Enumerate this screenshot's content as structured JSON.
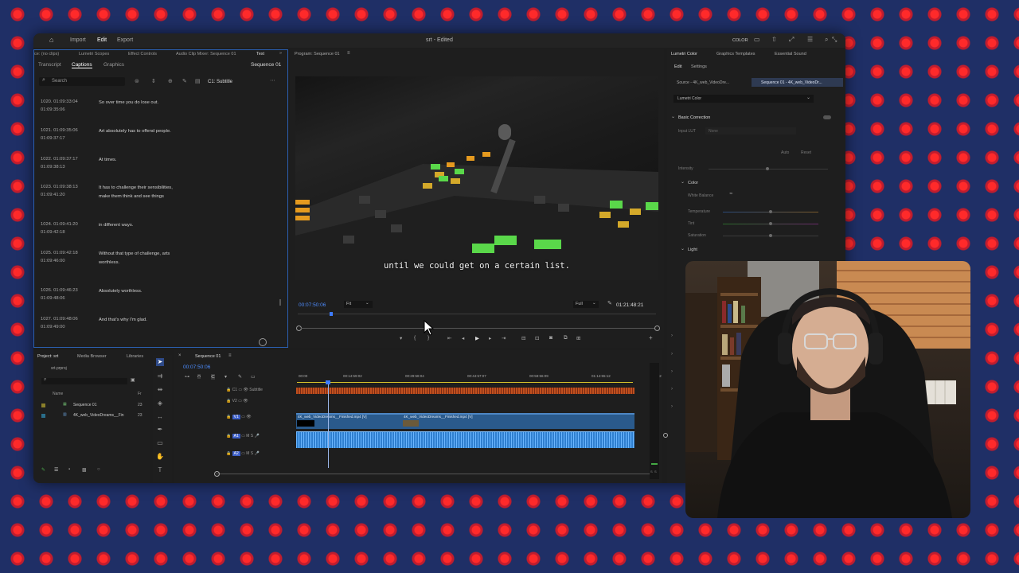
{
  "topbar": {
    "home_icon": "home-icon",
    "menu": [
      "Import",
      "Edit",
      "Export"
    ],
    "active_menu": "Edit",
    "title": "srt - Edited",
    "color_label": "COLOR"
  },
  "left_panel": {
    "tabs_row1": [
      "ce: (no clips)",
      "Lumetri Scopes",
      "Effect Controls",
      "Audio Clip Mixer: Sequence 01",
      "Text"
    ],
    "tabs_row2": [
      "Transcript",
      "Captions",
      "Graphics"
    ],
    "sequence_label": "Sequence 01",
    "search_placeholder": "Search",
    "track_label": "C1: Subtitle",
    "captions": [
      {
        "num": "1020. 01:09:33:04",
        "end": "01:09:35:06",
        "text": "So over time you do lose out."
      },
      {
        "num": "1021. 01:09:35:06",
        "end": "01:09:37:17",
        "text": "Art absolutely has to offend people."
      },
      {
        "num": "1022. 01:09:37:17",
        "end": "01:09:38:13",
        "text": "At times."
      },
      {
        "num": "1023. 01:09:38:13",
        "end": "01:09:41:20",
        "text": "It has to challenge their sensibilities,\nmake them think and see things"
      },
      {
        "num": "1024. 01:09:41:20",
        "end": "01:09:42:18",
        "text": "in different ways."
      },
      {
        "num": "1025. 01:09:42:18",
        "end": "01:09:46:00",
        "text": "Without that type of challenge, arts\nworthless."
      },
      {
        "num": "1026. 01:09:46:23",
        "end": "01:09:48:06",
        "text": "Absolutely worthless."
      },
      {
        "num": "1027. 01:09:48:06",
        "end": "01:09:49:00",
        "text": "And that's why I'm glad."
      }
    ]
  },
  "program_monitor": {
    "title": "Program: Sequence 01",
    "subtitle": "until we could get on a certain list.",
    "current_time": "00:07:50:06",
    "fit": "Fit",
    "quality": "Full",
    "duration": "01:21:48:21"
  },
  "lumetri": {
    "tabs": [
      "Lumetri Color",
      "Graphics Templates",
      "Essential Sound"
    ],
    "sub_tabs": [
      "Edit",
      "Settings"
    ],
    "source_label": "Source - 4K_web_VideoDre...",
    "sequence_label": "Sequence 01 - 4K_web_VideoDr...",
    "effect_dropdown": "Lumetri Color",
    "section_basic": "Basic Correction",
    "input_lut_label": "Input LUT",
    "input_lut_value": "None",
    "auto_label": "Auto",
    "reset_label": "Reset",
    "intensity_label": "Intensity",
    "color_section": "Color",
    "white_balance": "White Balance",
    "temperature": "Temperature",
    "tint": "Tint",
    "saturation": "Saturation",
    "light_section": "Light"
  },
  "project_panel": {
    "tabs": [
      "Project: srt",
      "Media Browser",
      "Libraries"
    ],
    "path": "srt.prproj",
    "name_header": "Name",
    "fr_header": "Fr",
    "items": [
      {
        "name": "Sequence 01",
        "fr": "23"
      },
      {
        "name": "4K_web_VideoDreams__Fin",
        "fr": "23"
      }
    ]
  },
  "timeline": {
    "tab": "Sequence 01",
    "current_time": "00:07:50:06",
    "ruler": [
      "00:00",
      "00:14:59:02",
      "00:29:58:04",
      "00:44:57:07",
      "00:59:56:09",
      "01:14:55:12",
      "01:2"
    ],
    "tracks": [
      {
        "name": "C1",
        "label": "Subtitle"
      },
      {
        "name": "V2",
        "label": ""
      },
      {
        "name": "V1",
        "label": ""
      },
      {
        "name": "A1",
        "label": ""
      },
      {
        "name": "A2",
        "label": ""
      }
    ],
    "clip1": "4K_web_VideoDreams__Finished.mp4 [V]",
    "clip2": "4K_web_VideoDreams__Finished.mp4 [V]",
    "meter_labels": [
      "S",
      "S"
    ]
  }
}
